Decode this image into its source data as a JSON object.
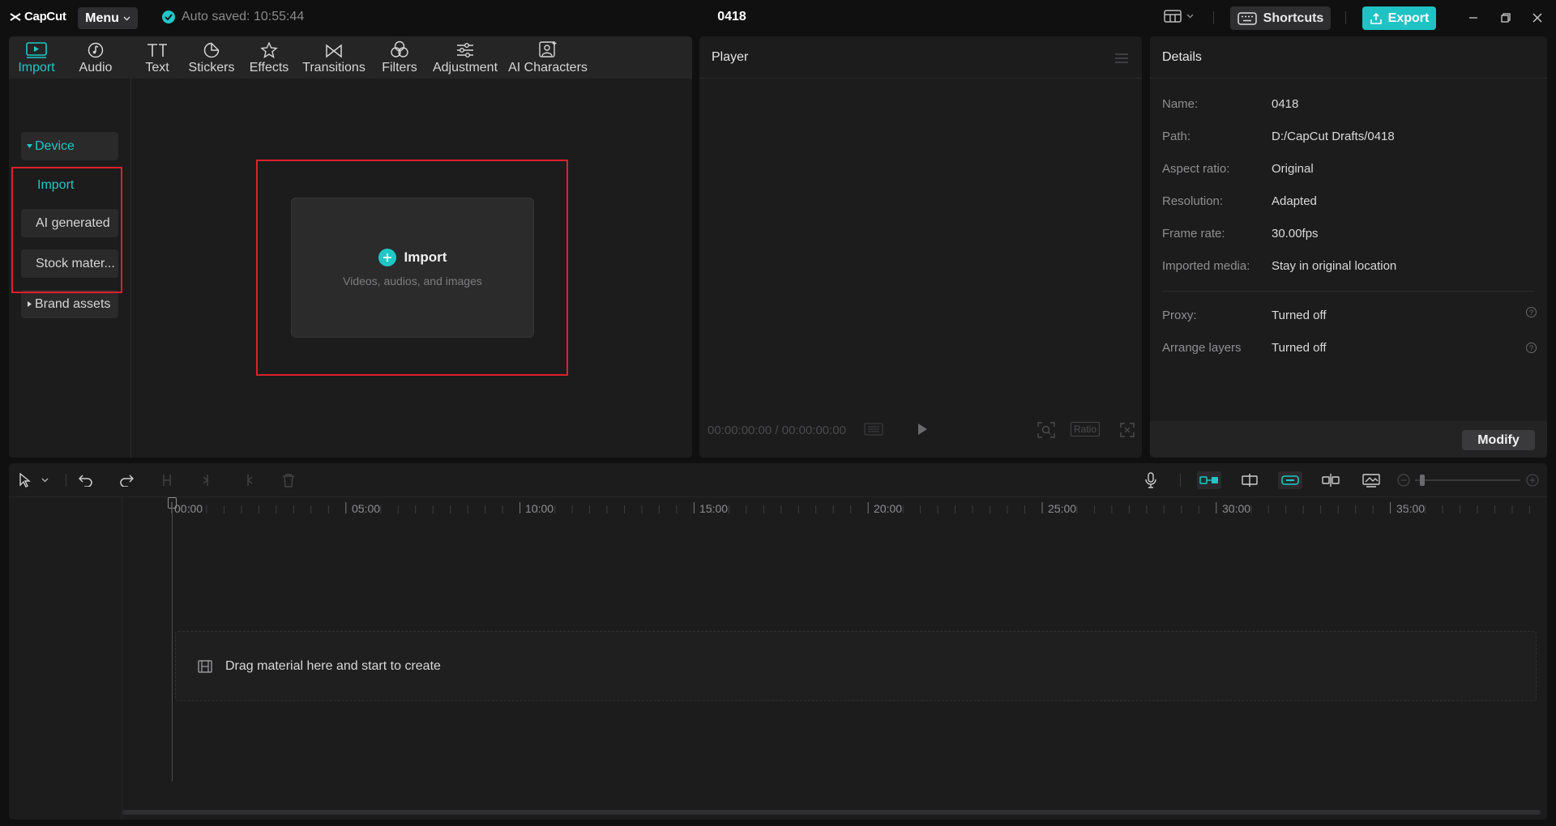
{
  "app": {
    "logo_text": "CapCut",
    "menu_label": "Menu",
    "autosave_text": "Auto saved: 10:55:44",
    "project_title": "0418",
    "shortcuts_label": "Shortcuts",
    "export_label": "Export",
    "accent_color": "#22c6c7"
  },
  "media_tabs": [
    {
      "label": "Import",
      "icon": "import-icon"
    },
    {
      "label": "Audio",
      "icon": "audio-icon"
    },
    {
      "label": "Text",
      "icon": "text-icon"
    },
    {
      "label": "Stickers",
      "icon": "stickers-icon"
    },
    {
      "label": "Effects",
      "icon": "effects-icon"
    },
    {
      "label": "Transitions",
      "icon": "transitions-icon"
    },
    {
      "label": "Filters",
      "icon": "filters-icon"
    },
    {
      "label": "Adjustment",
      "icon": "adjustment-icon"
    },
    {
      "label": "AI Characters",
      "icon": "ai-characters-icon"
    }
  ],
  "side_nav": {
    "device": "Device",
    "import": "Import",
    "ai_generated": "AI generated",
    "stock": "Stock mater...",
    "brand": "Brand assets"
  },
  "import_box": {
    "title": "Import",
    "subtitle": "Videos, audios, and images"
  },
  "player": {
    "title": "Player",
    "time": "00:00:00:00 / 00:00:00:00",
    "ratio_label": "Ratio"
  },
  "details": {
    "title": "Details",
    "rows": [
      {
        "key": "Name:",
        "value": "0418"
      },
      {
        "key": "Path:",
        "value": "D:/CapCut Drafts/0418"
      },
      {
        "key": "Aspect ratio:",
        "value": "Original"
      },
      {
        "key": "Resolution:",
        "value": "Adapted"
      },
      {
        "key": "Frame rate:",
        "value": "30.00fps"
      },
      {
        "key": "Imported media:",
        "value": "Stay in original location"
      },
      {
        "key": "Proxy:",
        "value": "Turned off"
      },
      {
        "key": "Arrange layers",
        "value": "Turned off"
      }
    ],
    "modify_label": "Modify"
  },
  "timeline": {
    "ticks": [
      "00:00",
      "05:00",
      "10:00",
      "15:00",
      "20:00",
      "25:00",
      "30:00",
      "35:00"
    ],
    "drop_text": "Drag material here and start to create"
  }
}
